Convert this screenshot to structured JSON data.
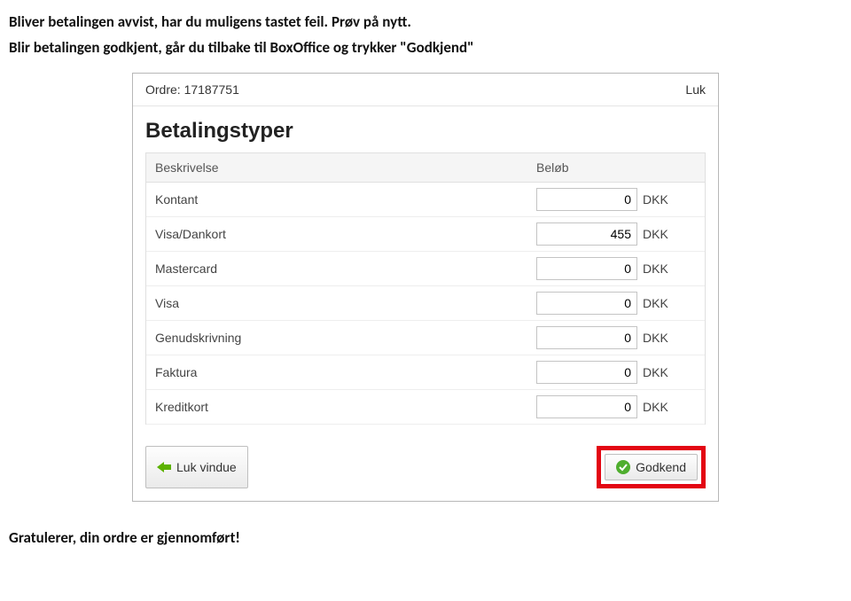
{
  "instructions": {
    "line1": "Bliver betalingen avvist, har du muligens tastet feil. Prøv på nytt.",
    "line2": "Blir betalingen godkjent, går du tilbake til BoxOffice og trykker \"Godkjend\""
  },
  "panel": {
    "order_label": "Ordre: 17187751",
    "close_label": "Luk",
    "title": "Betalingstyper",
    "columns": {
      "desc": "Beskrivelse",
      "amount": "Beløb"
    },
    "rows": [
      {
        "desc": "Kontant",
        "value": "0",
        "currency": "DKK"
      },
      {
        "desc": "Visa/Dankort",
        "value": "455",
        "currency": "DKK"
      },
      {
        "desc": "Mastercard",
        "value": "0",
        "currency": "DKK"
      },
      {
        "desc": "Visa",
        "value": "0",
        "currency": "DKK"
      },
      {
        "desc": "Genudskrivning",
        "value": "0",
        "currency": "DKK"
      },
      {
        "desc": "Faktura",
        "value": "0",
        "currency": "DKK"
      },
      {
        "desc": "Kreditkort",
        "value": "0",
        "currency": "DKK"
      }
    ],
    "buttons": {
      "close_window": "Luk vindue",
      "approve": "Godkend"
    }
  },
  "footer": "Gratulerer, din ordre er gjennomført!"
}
